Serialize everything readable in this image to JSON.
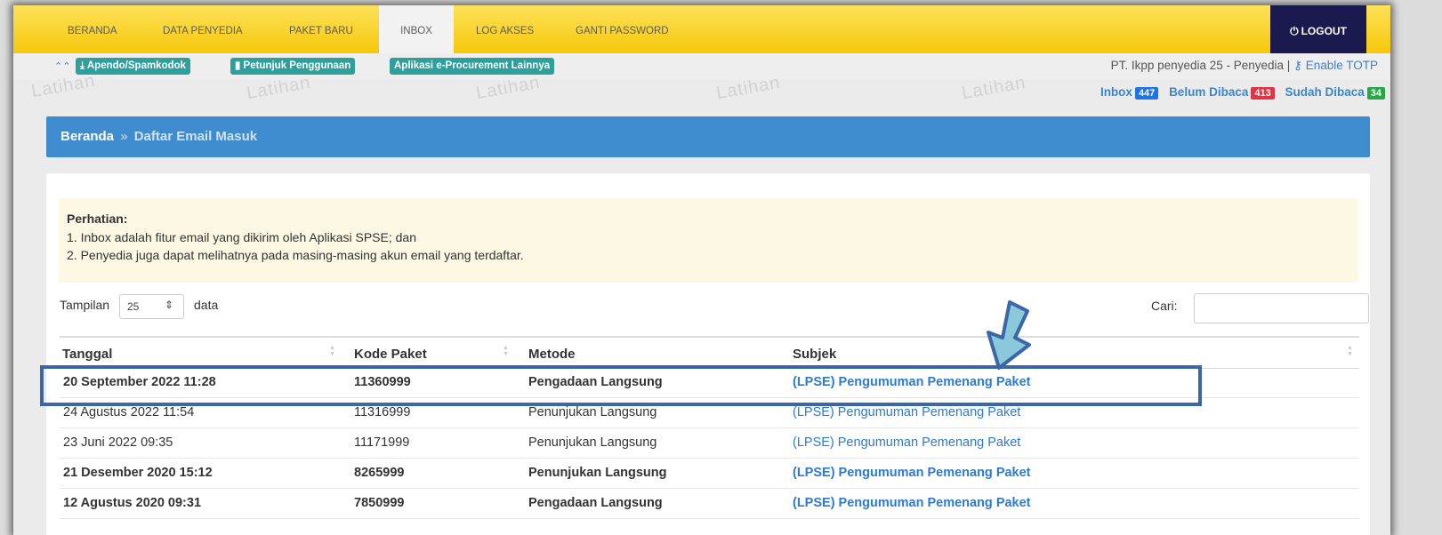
{
  "nav": {
    "items": [
      {
        "label": "BERANDA"
      },
      {
        "label": "DATA PENYEDIA"
      },
      {
        "label": "PAKET BARU"
      },
      {
        "label": "INBOX"
      },
      {
        "label": "LOG AKSES"
      },
      {
        "label": "GANTI PASSWORD"
      }
    ],
    "active": "INBOX",
    "logout_label": "LOGOUT"
  },
  "subbar": {
    "links": [
      {
        "label": "Apendo/Spamkodok",
        "icon": "download-icon"
      },
      {
        "label": "Petunjuk Penggunaan",
        "icon": "book-icon"
      },
      {
        "label": "Aplikasi e-Procurement Lainnya"
      }
    ],
    "user_text": "PT. Ikpp penyedia 25 - Penyedia |",
    "totp_label": "Enable TOTP",
    "totp_icon": "key-icon"
  },
  "watermark": "Latihan",
  "counts": {
    "inbox_label": "Inbox",
    "inbox_count": "447",
    "unread_label": "Belum Dibaca",
    "unread_count": "413",
    "read_label": "Sudah Dibaca",
    "read_count": "34"
  },
  "breadcrumb": {
    "home": "Beranda",
    "sep": "»",
    "current": "Daftar Email Masuk"
  },
  "alert": {
    "title": "Perhatian:",
    "lines": [
      "1. Inbox adalah fitur email yang dikirim oleh Aplikasi SPSE; dan",
      "2. Penyedia juga dapat melihatnya pada masing-masing akun email yang terdaftar."
    ]
  },
  "controls": {
    "show_label": "Tampilan",
    "page_size": "25",
    "data_label": "data",
    "search_label": "Cari:",
    "search_value": ""
  },
  "table": {
    "headers": [
      "Tanggal",
      "Kode Paket",
      "Metode",
      "Subjek"
    ],
    "rows": [
      {
        "tanggal": "20 September 2022 11:28",
        "kode": "11360999",
        "metode": "Pengadaan Langsung",
        "subjek": "(LPSE) Pengumuman Pemenang Paket",
        "unread": true
      },
      {
        "tanggal": "24 Agustus 2022 11:54",
        "kode": "11316999",
        "metode": "Penunjukan Langsung",
        "subjek": "(LPSE) Pengumuman Pemenang Paket",
        "unread": false
      },
      {
        "tanggal": "23 Juni 2022 09:35",
        "kode": "11171999",
        "metode": "Penunjukan Langsung",
        "subjek": "(LPSE) Pengumuman Pemenang Paket",
        "unread": false
      },
      {
        "tanggal": "21 Desember 2020 15:12",
        "kode": "8265999",
        "metode": "Penunjukan Langsung",
        "subjek": "(LPSE) Pengumuman Pemenang Paket",
        "unread": true
      },
      {
        "tanggal": "12 Agustus 2020 09:31",
        "kode": "7850999",
        "metode": "Pengadaan Langsung",
        "subjek": "(LPSE) Pengumuman Pemenang Paket",
        "unread": true
      }
    ]
  },
  "colors": {
    "nav_yellow": "#f9d21f",
    "logout_bg": "#1a1a4e",
    "breadcrumb_bg": "#3f8dcf",
    "badge_inbox": "#1e73e6",
    "badge_unread": "#dc3545",
    "badge_read": "#28a745",
    "link": "#2b7bd6",
    "annotation": "#3b67a6"
  }
}
